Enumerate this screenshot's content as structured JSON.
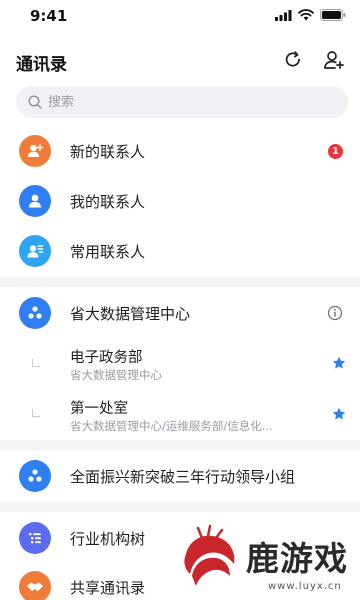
{
  "status_bar": {
    "time": "9:41"
  },
  "header": {
    "title": "通讯录",
    "refresh_icon": "refresh-icon",
    "add_contact_icon": "add-user-icon"
  },
  "search": {
    "placeholder": "搜索"
  },
  "quick_items": [
    {
      "label": "新的联系人",
      "icon": "add-contact-icon",
      "color": "#f07c3a",
      "badge": "1"
    },
    {
      "label": "我的联系人",
      "icon": "person-icon",
      "color": "#2f7ef2"
    },
    {
      "label": "常用联系人",
      "icon": "frequent-contact-icon",
      "color": "#2fa4f2"
    }
  ],
  "org": {
    "label": "省大数据管理中心",
    "icon": "org-icon",
    "color": "#2f7ef2",
    "departments": [
      {
        "title": "电子政务部",
        "path": "省大数据管理中心"
      },
      {
        "title": "第一处室",
        "path": "省大数据管理中心/运维服务部/信息化..."
      }
    ]
  },
  "group": {
    "label": "全面振兴新突破三年行动领导小组",
    "icon": "org-icon",
    "color": "#2f7ef2"
  },
  "bottom_items": [
    {
      "label": "行业机构树",
      "icon": "list-tree-icon",
      "color": "#5b6cf0"
    },
    {
      "label": "共享通讯录",
      "icon": "handshake-icon",
      "color": "#f07c3a"
    }
  ],
  "watermark": {
    "text": "鹿游戏",
    "url": "www.luyx.cn"
  },
  "colors": {
    "accent": "#2f7ef2",
    "badge": "#e8343a",
    "divider": "#f3f4f6"
  }
}
